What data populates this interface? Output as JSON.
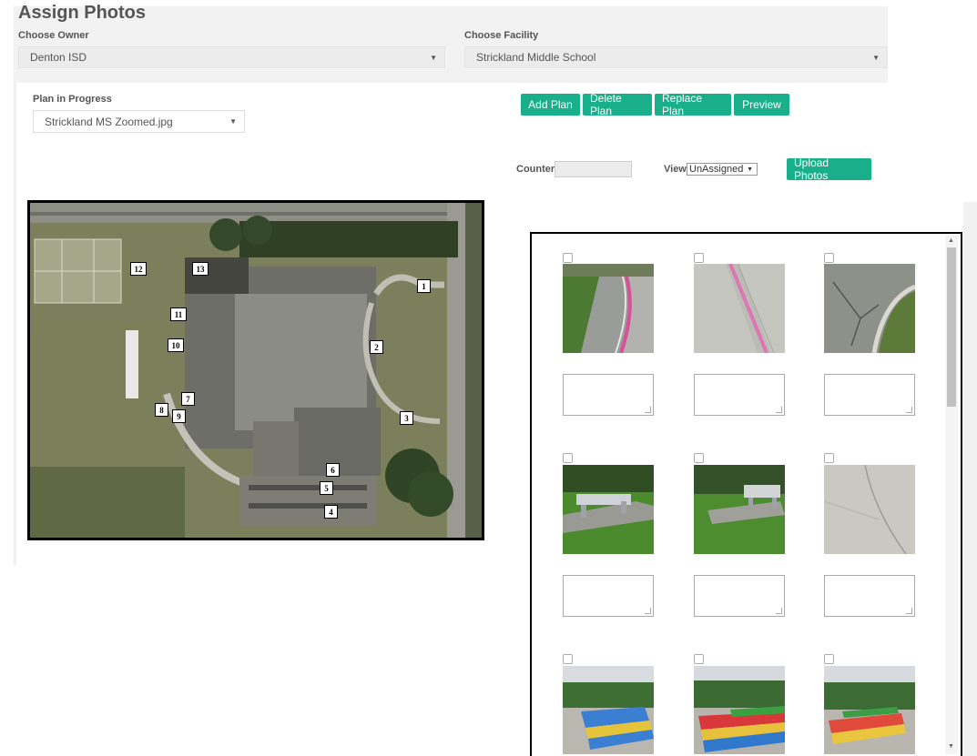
{
  "page": {
    "title": "Assign Photos"
  },
  "owner": {
    "label": "Choose Owner",
    "value": "Denton ISD"
  },
  "facility": {
    "label": "Choose Facility",
    "value": "Strickland Middle School"
  },
  "plan": {
    "label": "Plan in Progress",
    "value": "Strickland MS Zoomed.jpg"
  },
  "toolbar": {
    "add_plan": "Add Plan",
    "delete_plan": "Delete Plan",
    "replace_plan": "Replace Plan",
    "preview": "Preview",
    "upload_photos": "Upload Photos"
  },
  "counter": {
    "label": "Counter",
    "value": ""
  },
  "view": {
    "label": "View",
    "value": "UnAssigned"
  },
  "map": {
    "markers": [
      "1",
      "2",
      "3",
      "4",
      "5",
      "6",
      "7",
      "8",
      "9",
      "10",
      "11",
      "12",
      "13"
    ]
  },
  "photos": [
    {
      "scene": "curb-pink-left"
    },
    {
      "scene": "curb-pink-top"
    },
    {
      "scene": "cracked-curb"
    },
    {
      "scene": "bench-lawn-left"
    },
    {
      "scene": "bench-lawn-right"
    },
    {
      "scene": "concrete-crack"
    },
    {
      "scene": "picnic-tables-1"
    },
    {
      "scene": "picnic-tables-2"
    },
    {
      "scene": "picnic-tables-3"
    }
  ],
  "colors": {
    "accent": "#1aaf8b",
    "panel_bg": "#f2f2f2"
  }
}
